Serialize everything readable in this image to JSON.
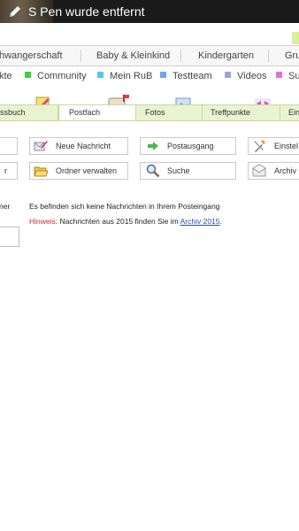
{
  "status_bar": {
    "message": "S Pen wurde entfernt"
  },
  "nav_top": [
    "hwangerschaft",
    "Baby & Kleinkind",
    "Kindergarten",
    "Gru"
  ],
  "categories": [
    {
      "label": "kte",
      "color": "#e6a23c"
    },
    {
      "label": "Community",
      "color": "#3fd03f"
    },
    {
      "label": "Mein RuB",
      "color": "#53c9e8"
    },
    {
      "label": "Testteam",
      "color": "#6fa6e8"
    },
    {
      "label": "Videos",
      "color": "#9aa6d8"
    },
    {
      "label": "Su",
      "color": "#e86fd2"
    }
  ],
  "tabs": [
    "ssbuch",
    "Postfach",
    "Fotos",
    "Treffpunkte",
    "Ein"
  ],
  "buttons": {
    "left1": "",
    "left2": "r",
    "new_message": "Neue Nachricht",
    "outbox": "Postausgang",
    "settings": "Einstel",
    "manage_folders": "Ordner verwalten",
    "search": "Suche",
    "archive": "Archiv"
  },
  "main": {
    "left_cut_label": "ner",
    "empty_text": "Es befinden sich keine Nachrichten in Ihrem Posteingang",
    "hint_label": "Hinweis:",
    "hint_text": "Nachrichten aus 2015 finden Sie im",
    "archive_link": "Archiv 2015",
    "hint_end": "."
  }
}
